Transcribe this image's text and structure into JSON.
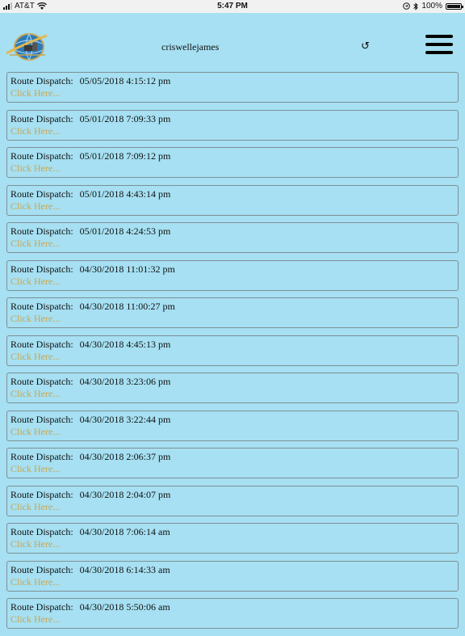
{
  "status_bar": {
    "carrier": "AT&T",
    "time": "5:47 PM",
    "battery": "100%"
  },
  "header": {
    "username": "criswellejames",
    "refresh_glyph": "↺"
  },
  "items": [
    {
      "label": "Route Dispatch:",
      "date": "05/05/2018 4:15:12 pm",
      "link": "Click Here..."
    },
    {
      "label": "Route Dispatch:",
      "date": "05/01/2018 7:09:33 pm",
      "link": "Click Here..."
    },
    {
      "label": "Route Dispatch:",
      "date": "05/01/2018 7:09:12 pm",
      "link": "Click Here..."
    },
    {
      "label": "Route Dispatch:",
      "date": "05/01/2018 4:43:14 pm",
      "link": "Click Here..."
    },
    {
      "label": "Route Dispatch:",
      "date": "05/01/2018 4:24:53 pm",
      "link": "Click Here..."
    },
    {
      "label": "Route Dispatch:",
      "date": "04/30/2018 11:01:32 pm",
      "link": "Click Here..."
    },
    {
      "label": "Route Dispatch:",
      "date": "04/30/2018 11:00:27 pm",
      "link": "Click Here..."
    },
    {
      "label": "Route Dispatch:",
      "date": "04/30/2018 4:45:13 pm",
      "link": "Click Here..."
    },
    {
      "label": "Route Dispatch:",
      "date": "04/30/2018 3:23:06 pm",
      "link": "Click Here..."
    },
    {
      "label": "Route Dispatch:",
      "date": "04/30/2018 3:22:44 pm",
      "link": "Click Here..."
    },
    {
      "label": "Route Dispatch:",
      "date": "04/30/2018 2:06:37 pm",
      "link": "Click Here..."
    },
    {
      "label": "Route Dispatch:",
      "date": "04/30/2018 2:04:07 pm",
      "link": "Click Here..."
    },
    {
      "label": "Route Dispatch:",
      "date": "04/30/2018 7:06:14 am",
      "link": "Click Here..."
    },
    {
      "label": "Route Dispatch:",
      "date": "04/30/2018 6:14:33 am",
      "link": "Click Here..."
    },
    {
      "label": "Route Dispatch:",
      "date": "04/30/2018 5:50:06 am",
      "link": "Click Here..."
    }
  ],
  "colors": {
    "background": "#a6e0f2",
    "link": "#c9a653",
    "status_bar": "#f1f1f1"
  },
  "icons": [
    "signal-icon",
    "wifi-icon",
    "location-icon",
    "bluetooth-icon",
    "battery-icon",
    "globe-logo",
    "refresh-icon",
    "hamburger-menu-icon"
  ]
}
